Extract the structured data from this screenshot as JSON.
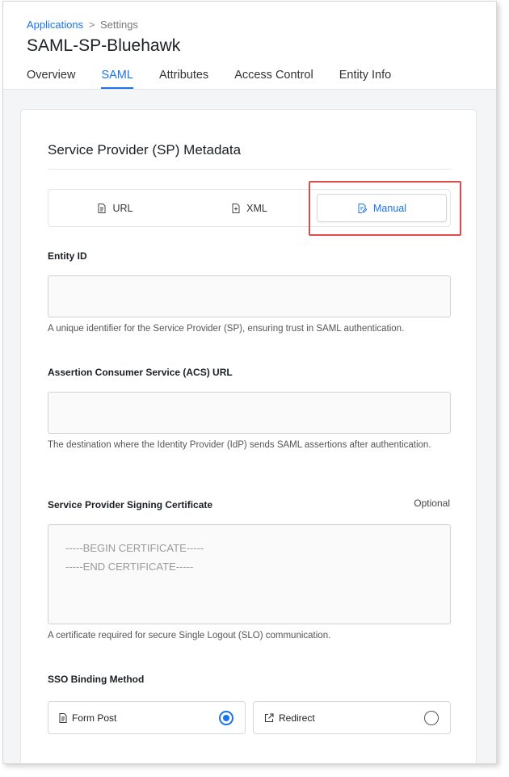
{
  "breadcrumb": {
    "parent": "Applications",
    "separator": ">",
    "current": "Settings"
  },
  "page": {
    "title": "SAML-SP-Bluehawk"
  },
  "tabs": [
    {
      "label": "Overview",
      "active": false
    },
    {
      "label": "SAML",
      "active": true
    },
    {
      "label": "Attributes",
      "active": false
    },
    {
      "label": "Access Control",
      "active": false
    },
    {
      "label": "Entity Info",
      "active": false
    }
  ],
  "metadata": {
    "title": "Service Provider (SP) Metadata",
    "options": [
      {
        "label": "URL",
        "icon": "document-icon",
        "selected": false
      },
      {
        "label": "XML",
        "icon": "file-code-icon",
        "selected": false
      },
      {
        "label": "Manual",
        "icon": "edit-document-icon",
        "selected": true
      }
    ]
  },
  "fields": {
    "entity_id": {
      "label": "Entity ID",
      "value": "",
      "help": "A unique identifier for the Service Provider (SP), ensuring trust in SAML authentication."
    },
    "acs_url": {
      "label": "Assertion Consumer Service (ACS) URL",
      "value": "",
      "help": "The destination where the Identity Provider (IdP) sends SAML assertions after authentication."
    },
    "signing_cert": {
      "label": "Service Provider Signing Certificate",
      "optional": "Optional",
      "placeholder": "-----BEGIN CERTIFICATE-----\n-----END CERTIFICATE-----",
      "help": "A certificate required for secure Single Logout (SLO) communication."
    }
  },
  "sso_binding": {
    "label": "SSO Binding Method",
    "options": [
      {
        "label": "Form Post",
        "icon": "document-icon",
        "selected": true
      },
      {
        "label": "Redirect",
        "icon": "external-link-icon",
        "selected": false
      }
    ]
  },
  "colors": {
    "accent": "#1a73e8",
    "highlight": "#e04a4a"
  }
}
